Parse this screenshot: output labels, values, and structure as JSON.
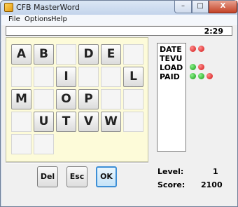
{
  "window": {
    "title": "CFB MasterWord",
    "min_label": "–",
    "max_label": "□",
    "close_label": "X"
  },
  "menu": {
    "file": "File",
    "options": "Options",
    "help": "Help"
  },
  "timer": "2:29",
  "board": {
    "rows": [
      [
        "A",
        "B",
        "",
        "D",
        "E",
        ""
      ],
      [
        "",
        "",
        "I",
        "",
        "",
        "L"
      ],
      [
        "M",
        "",
        "O",
        "P",
        "",
        ""
      ],
      [
        "",
        "U",
        "T",
        "V",
        "W",
        ""
      ],
      [
        "",
        "",
        "",
        "",
        "",
        ""
      ]
    ]
  },
  "buttons": {
    "del": "Del",
    "esc": "Esc",
    "ok": "OK"
  },
  "words": [
    {
      "text": "DATE",
      "dots": [
        "red",
        "red"
      ]
    },
    {
      "text": "TEVU",
      "dots": []
    },
    {
      "text": "LOAD",
      "dots": [
        "green",
        "red"
      ]
    },
    {
      "text": "PAID",
      "dots": [
        "green",
        "green",
        "red"
      ]
    }
  ],
  "status": {
    "level_label": "Level:",
    "level_value": "1",
    "score_label": "Score:",
    "score_value": "2100"
  }
}
